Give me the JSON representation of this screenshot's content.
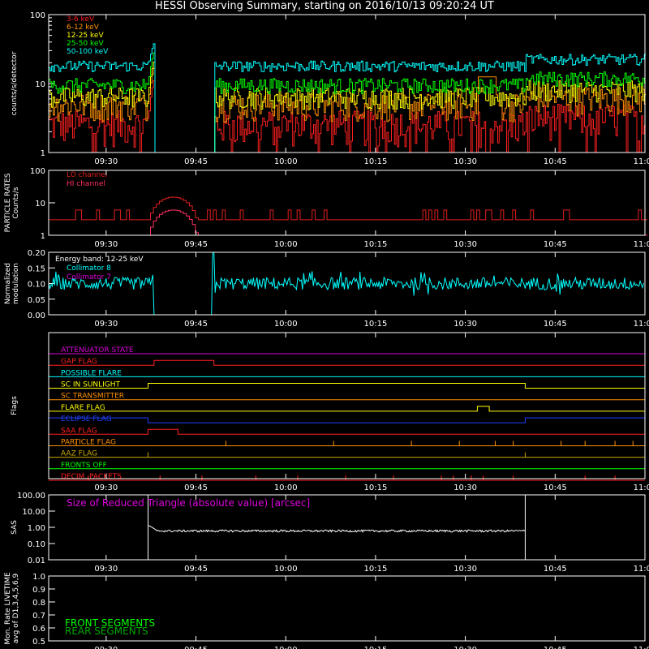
{
  "title": "HESSI Observing Summary, starting on 2016/10/13 09:20:24 UT",
  "time_ticks": [
    "09:30",
    "09:45",
    "10:00",
    "10:15",
    "10:30",
    "10:45",
    "11:00"
  ],
  "chart_data": [
    {
      "type": "line",
      "name": "counts",
      "ylabel": "counts/s/detector",
      "ylim": [
        1,
        100
      ],
      "y_scale": "log",
      "y_ticks": [
        "1",
        "10",
        "100"
      ],
      "legend_position": "top-left",
      "series": [
        {
          "name": "3-6 keV",
          "color": "#ff2020",
          "base": 2.6,
          "peak_value": 12
        },
        {
          "name": "6-12 keV",
          "color": "#ff9000",
          "base": 5.0,
          "peak_value": 18
        },
        {
          "name": "12-25 keV",
          "color": "#ffff00",
          "base": 6.5,
          "peak_value": 22
        },
        {
          "name": "25-50 keV",
          "color": "#00ff00",
          "base": 9.5,
          "peak_value": 30
        },
        {
          "name": "50-100 keV",
          "color": "#00ffff",
          "base": 18,
          "peak_value": 40
        }
      ],
      "events": [
        {
          "time": "09:37",
          "description": "rise"
        },
        {
          "time": "09:38",
          "description": "data gap start"
        },
        {
          "time": "09:48",
          "description": "data gap end"
        },
        {
          "time": "10:33",
          "description": "6-12 keV bump"
        }
      ]
    },
    {
      "type": "line",
      "name": "particle",
      "ylabel": "PARTICLE RATES",
      "ylabel2": "Counts/s",
      "ylim": [
        1,
        100
      ],
      "y_scale": "log",
      "y_ticks": [
        "1",
        "10",
        "100"
      ],
      "series": [
        {
          "name": "LO channel",
          "color": "#e0201c",
          "base": 3,
          "peak_value": 15
        },
        {
          "name": "HI channel",
          "color": "#ff3060",
          "base": 1,
          "peak_value": 6
        }
      ]
    },
    {
      "type": "line",
      "name": "modulation",
      "ylabel": "Normalized",
      "ylabel2": "modulation",
      "ylim": [
        0,
        0.2
      ],
      "y_ticks": [
        "0.00",
        "0.05",
        "0.10",
        "0.15",
        "0.20"
      ],
      "annotation": "Energy band: 12-25 keV",
      "series": [
        {
          "name": "Collimator 8",
          "color": "#00ffff",
          "base": 0.1,
          "spread": 0.02
        },
        {
          "name": "Collimator 7",
          "color": "#dd00dd",
          "base": 0.0
        }
      ]
    },
    {
      "type": "line",
      "name": "flags",
      "ylabel": "Flags",
      "flags": [
        {
          "name": "ATTENUATOR STATE",
          "color": "#dd00dd",
          "on": []
        },
        {
          "name": "GAP FLAG",
          "color": "#ff2020",
          "on": [
            [
              "09:38",
              "09:48"
            ]
          ]
        },
        {
          "name": "POSSIBLE FLARE",
          "color": "#00ffff",
          "on": []
        },
        {
          "name": "SC IN SUNLIGHT",
          "color": "#ffff00",
          "on": [
            [
              "09:37",
              "10:40"
            ]
          ]
        },
        {
          "name": "SC TRANSMITTER",
          "color": "#ff9000",
          "on": []
        },
        {
          "name": "FLARE FLAG",
          "color": "#ffff00",
          "on": [
            [
              "10:32",
              "10:34"
            ]
          ]
        },
        {
          "name": "ECLIPSE FLAG",
          "color": "#2040ff",
          "on": [
            [
              "09:20",
              "09:37"
            ],
            [
              "10:40",
              "11:00"
            ]
          ]
        },
        {
          "name": "SAA FLAG",
          "color": "#ff2020",
          "on": [
            [
              "09:37",
              "09:42"
            ]
          ]
        },
        {
          "name": "PARTICLE FLAG",
          "color": "#ff9000",
          "spikes": [
            "09:25",
            "09:50",
            "10:08",
            "10:21",
            "10:29",
            "10:35",
            "10:38",
            "10:46",
            "10:50",
            "10:55",
            "10:58"
          ]
        },
        {
          "name": "AAZ FLAG",
          "color": "#ccaa00",
          "spikes": [
            "09:37",
            "10:40"
          ]
        },
        {
          "name": "FRONTS OFF",
          "color": "#00ff00",
          "on": []
        },
        {
          "name": "DECIM. PACKETS",
          "color": "#ff2020",
          "spikes": [
            "09:27",
            "09:39",
            "09:46",
            "09:55",
            "10:02",
            "10:10",
            "10:18",
            "10:26",
            "10:28",
            "10:31",
            "10:33",
            "10:38",
            "10:50",
            "10:55"
          ]
        }
      ]
    },
    {
      "type": "line",
      "name": "sas",
      "ylabel": "SAS",
      "y_scale": "log",
      "ylim": [
        0.01,
        100
      ],
      "y_ticks": [
        "0.01",
        "0.10",
        "1.00",
        "10.00",
        "100.00"
      ],
      "annotation": "Size of Reduced Triangle (absolute value) [arcsec]",
      "series": [
        {
          "name": "SAS",
          "color": "#ffffff",
          "base": 0.6,
          "spikes": [
            "09:37",
            "10:40"
          ]
        }
      ]
    },
    {
      "type": "line",
      "name": "livetime",
      "ylabel": "Mon. Rate LIVETIME",
      "ylabel2": "avg of D1,3,4,5,6,9",
      "ylim": [
        0.5,
        1.0
      ],
      "y_ticks": [
        "0.5",
        "0.6",
        "0.7",
        "0.8",
        "0.9",
        "1.0"
      ],
      "series": [
        {
          "name": "FRONT SEGMENTS",
          "color": "#00ff00"
        },
        {
          "name": "REAR SEGMENTS",
          "color": "#00aa00"
        }
      ]
    }
  ]
}
